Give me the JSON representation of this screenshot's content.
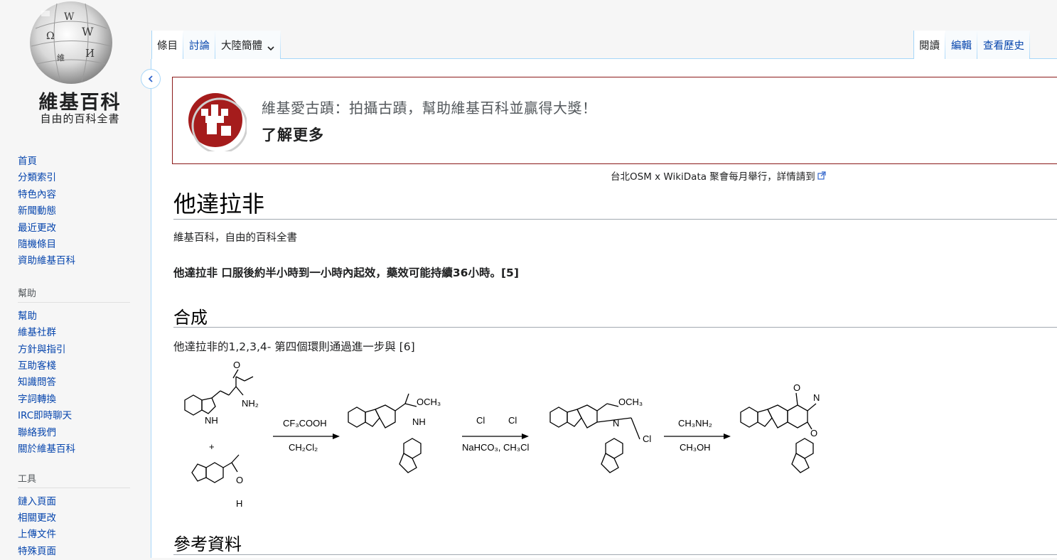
{
  "logo": {
    "wordmark": "維基百科",
    "tagline": "自由的百科全書"
  },
  "sidebar": {
    "navigation": [
      "首頁",
      "分類索引",
      "特色內容",
      "新聞動態",
      "最近更改",
      "隨機條目",
      "資助維基百科"
    ],
    "help_heading": "幫助",
    "help": [
      "幫助",
      "維基社群",
      "方針與指引",
      "互助客棧",
      "知識問答",
      "字詞轉換",
      "IRC即時聊天",
      "聯絡我們",
      "關於維基百科"
    ],
    "tools_heading": "工具",
    "tools": [
      "鏈入頁面",
      "相關更改",
      "上傳文件",
      "特殊頁面"
    ]
  },
  "tabs": {
    "article": "條目",
    "talk": "討論",
    "variant": "大陸簡體",
    "read": "閱讀",
    "edit": "編輯",
    "history": "查看歷史"
  },
  "banner": {
    "text": "維基愛古蹟：拍攝古蹟，幫助維基百科並贏得大獎！",
    "link": "了解更多",
    "subnotice": "台北OSM x WikiData 聚會每月舉行，詳情請到"
  },
  "article": {
    "title": "他達拉非",
    "site_sub": "維基百科，自由的百科全書",
    "lead": "他達拉非 口服後約半小時到一小時內起效，藥效可能持續36小時。[5]",
    "synthesis_heading": "合成",
    "synthesis_text": "他達拉非的1,2,3,4- 第四個環則通過進一步與 [6]",
    "references_heading": "參考資料"
  },
  "scheme": {
    "step1_top": "CF₃COOH",
    "step1_bottom": "CH₂Cl₂",
    "step2_bottom": "NaHCO₃, CH₃Cl",
    "step3_top": "CH₃NH₂",
    "step3_bottom": "CH₃OH",
    "plus": "+",
    "labels": {
      "nh2": "NH₂",
      "h": "H",
      "o": "O",
      "och3": "OCH₃",
      "nh": "NH",
      "n": "N",
      "cl": "Cl"
    }
  },
  "colors": {
    "link": "#0645ad",
    "tab_border": "#a7d7f9",
    "banner_border": "#8b1a1a",
    "banner_logo": "#a51c1c"
  }
}
